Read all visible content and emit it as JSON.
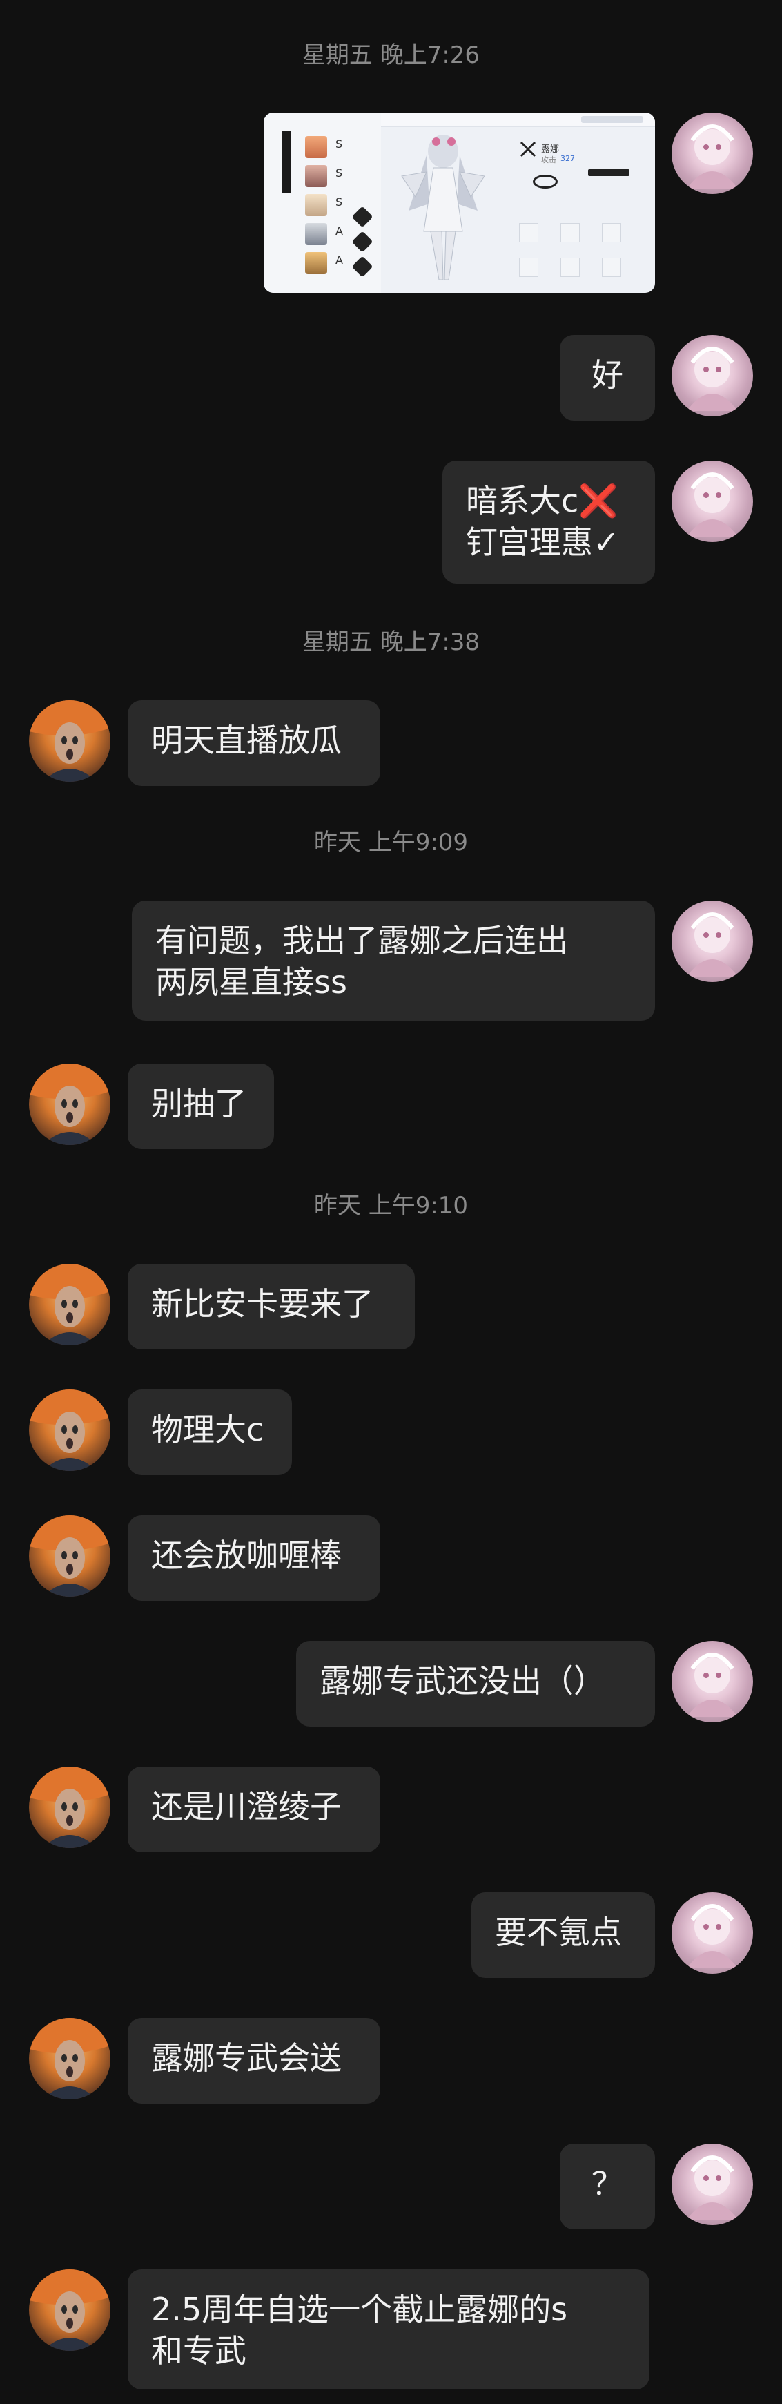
{
  "messages": [
    {
      "kind": "time",
      "text": "星期五 晚上7:26"
    },
    {
      "kind": "image",
      "side": "right",
      "image_text": {
        "name": "露娜",
        "level": "327",
        "atk_label": "攻击",
        "skill_rank": "S"
      }
    },
    {
      "kind": "text",
      "side": "right",
      "text": "好"
    },
    {
      "kind": "text",
      "side": "right",
      "text": "暗系大c❌\n钉宫理惠✓"
    },
    {
      "kind": "time",
      "text": "星期五 晚上7:38"
    },
    {
      "kind": "text",
      "side": "left",
      "text": "明天直播放瓜"
    },
    {
      "kind": "time",
      "text": "昨天 上午9:09"
    },
    {
      "kind": "text",
      "side": "right",
      "text": "有问题，我出了露娜之后连出\n两夙星直接ss"
    },
    {
      "kind": "text",
      "side": "left",
      "text": "别抽了"
    },
    {
      "kind": "time",
      "text": "昨天 上午9:10"
    },
    {
      "kind": "text",
      "side": "left",
      "text": "新比安卡要来了"
    },
    {
      "kind": "text",
      "side": "left",
      "text": "物理大c"
    },
    {
      "kind": "text",
      "side": "left",
      "text": "还会放咖喱棒"
    },
    {
      "kind": "text",
      "side": "right",
      "text": "露娜专武还没出（）"
    },
    {
      "kind": "text",
      "side": "left",
      "text": "还是川澄绫子"
    },
    {
      "kind": "text",
      "side": "right",
      "text": "要不氪点"
    },
    {
      "kind": "text",
      "side": "left",
      "text": "露娜专武会送"
    },
    {
      "kind": "text",
      "side": "right",
      "text": "？"
    },
    {
      "kind": "text",
      "side": "left",
      "text": "2.5周年自选一个截止露娜的s\n和专武"
    }
  ],
  "colors": {
    "background": "#111111",
    "bubble": "#2a2a2a",
    "timestamp": "#8a8a8a",
    "text": "#f2f2f2"
  },
  "icons": {
    "self_avatar": "anime-girl-avatar",
    "friend_avatar": "scream-painting-avatar",
    "cross_mark": "red-cross-emoji",
    "check_mark": "check-mark"
  }
}
